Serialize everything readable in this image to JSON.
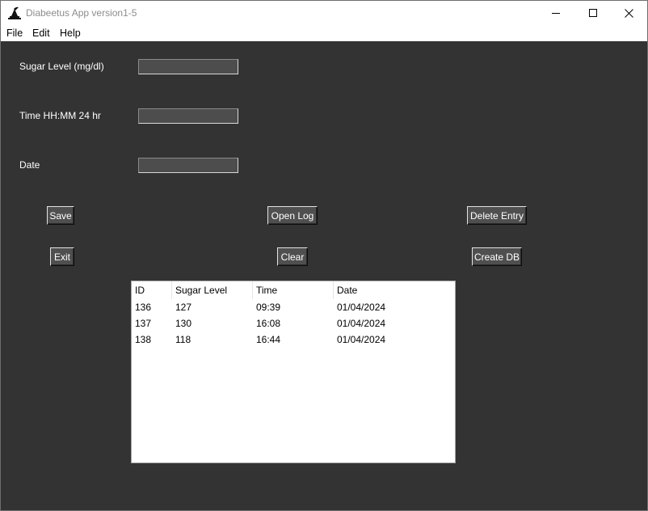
{
  "window": {
    "title": "Diabeetus App version1-5"
  },
  "menu": {
    "items": [
      "File",
      "Edit",
      "Help"
    ]
  },
  "form": {
    "sugar_label": "Sugar Level (mg/dl)",
    "sugar_value": "",
    "time_label": "Time HH:MM 24 hr",
    "time_value": "",
    "date_label": "Date",
    "date_value": ""
  },
  "buttons": {
    "save": "Save",
    "open_log": "Open Log",
    "delete_entry": "Delete Entry",
    "exit": "Exit",
    "clear": "Clear",
    "create_db": "Create DB"
  },
  "table": {
    "columns": [
      "ID",
      "Sugar Level",
      "Time",
      "Date"
    ],
    "rows": [
      [
        "136",
        "127",
        "09:39",
        "01/04/2024"
      ],
      [
        "137",
        "130",
        "16:08",
        "01/04/2024"
      ],
      [
        "138",
        "118",
        "16:44",
        "01/04/2024"
      ]
    ]
  },
  "colors": {
    "background": "#333333",
    "button_face": "#4f4f4f",
    "entry_field": "#4d4d4d",
    "table_background": "#ffffff"
  },
  "icons": {
    "app": "feather-icon",
    "minimize": "minimize-icon",
    "maximize": "maximize-icon",
    "close": "close-icon"
  }
}
